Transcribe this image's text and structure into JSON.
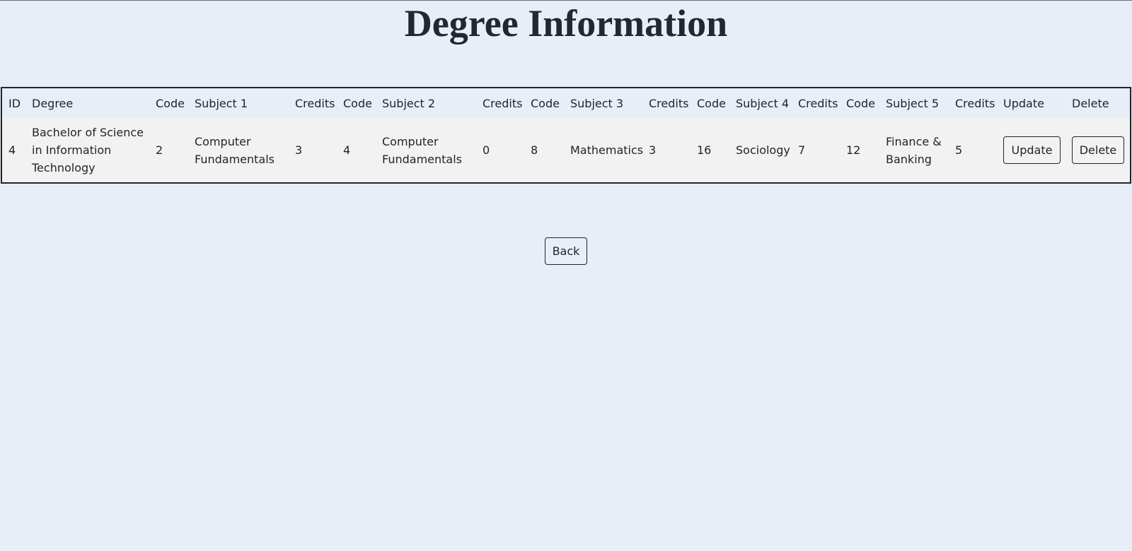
{
  "page": {
    "title": "Degree Information"
  },
  "table": {
    "headers": [
      "ID",
      "Degree",
      "Code",
      "Subject 1",
      "Credits",
      "Code",
      "Subject 2",
      "Credits",
      "Code",
      "Subject 3",
      "Credits",
      "Code",
      "Subject 4",
      "Credits",
      "Code",
      "Subject 5",
      "Credits",
      "Update",
      "Delete"
    ],
    "rows": [
      {
        "id": "4",
        "degree": "Bachelor of Science in Information Technology",
        "code1": "2",
        "subject1": "Computer Fundamentals",
        "credits1": "3",
        "code2": "4",
        "subject2": "Computer Fundamentals",
        "credits2": "0",
        "code3": "8",
        "subject3": "Mathematics",
        "credits3": "3",
        "code4": "16",
        "subject4": "Sociology",
        "credits4": "7",
        "code5": "12",
        "subject5": "Finance & Banking",
        "credits5": "5",
        "update_label": "Update",
        "delete_label": "Delete"
      }
    ]
  },
  "footer": {
    "back_label": "Back"
  }
}
